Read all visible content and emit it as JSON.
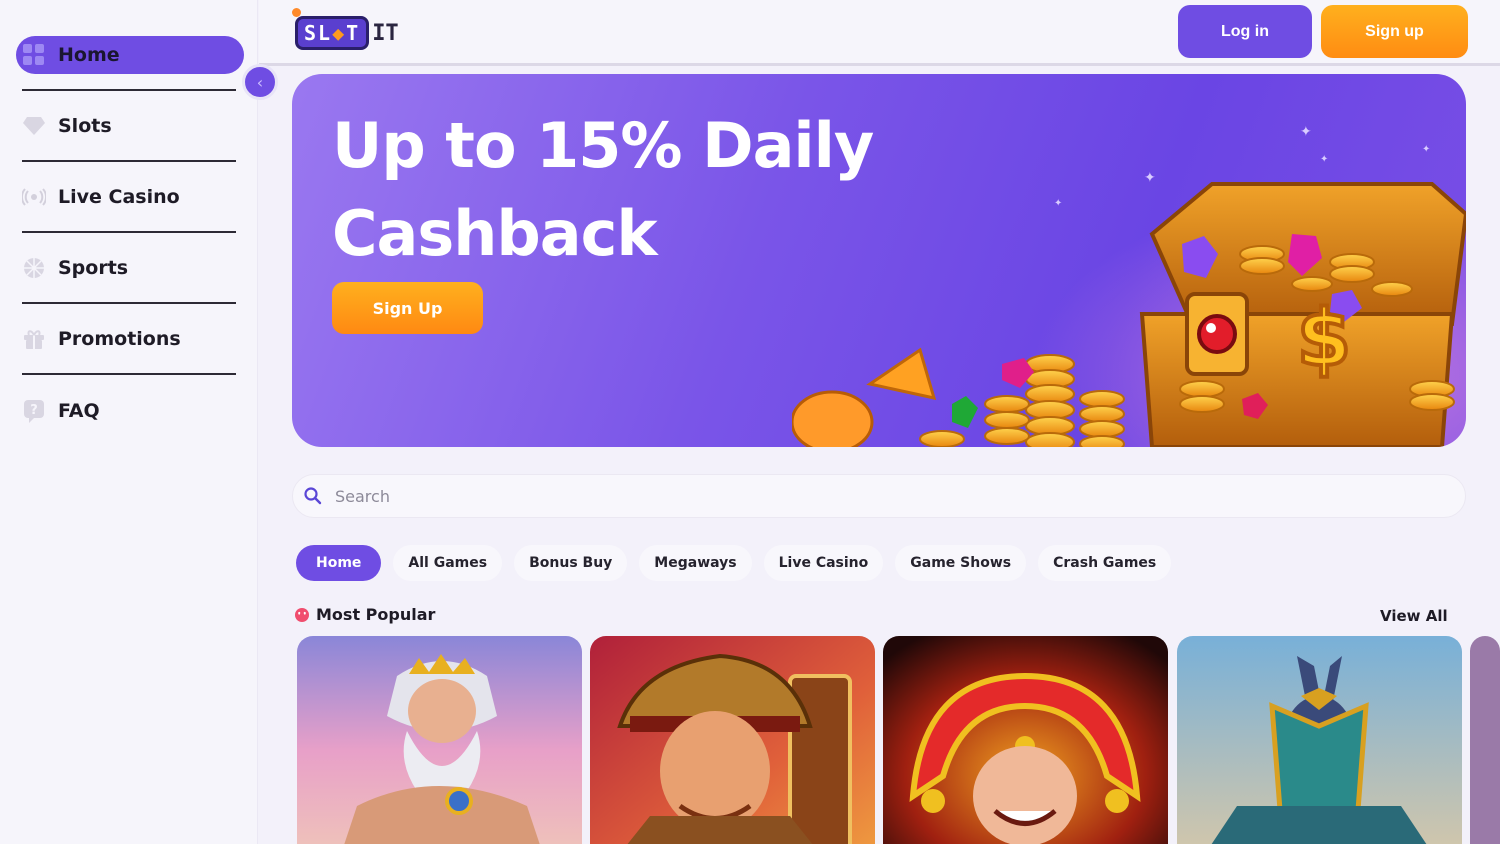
{
  "sidebar": {
    "items": [
      {
        "label": "Home",
        "icon": "grid-icon"
      },
      {
        "label": "Slots",
        "icon": "diamond-icon"
      },
      {
        "label": "Live Casino",
        "icon": "broadcast-icon"
      },
      {
        "label": "Sports",
        "icon": "ball-icon"
      },
      {
        "label": "Promotions",
        "icon": "gift-icon"
      },
      {
        "label": "FAQ",
        "icon": "question-icon"
      }
    ],
    "active": "Home"
  },
  "header": {
    "logo": "SLOTIT",
    "login_label": "Log in",
    "signup_label": "Sign up"
  },
  "banner": {
    "title_line1": "Up to 15% Daily",
    "title_line2": "Cashback",
    "cta_label": "Sign Up"
  },
  "search": {
    "placeholder": "Search",
    "value": ""
  },
  "tabs": [
    {
      "label": "Home"
    },
    {
      "label": "All Games"
    },
    {
      "label": "Bonus Buy"
    },
    {
      "label": "Megaways"
    },
    {
      "label": "Live Casino"
    },
    {
      "label": "Game Shows"
    },
    {
      "label": "Crash Games"
    }
  ],
  "section": {
    "title": "Most Popular",
    "view_all_label": "View All"
  },
  "colors": {
    "accent": "#6f4de3",
    "orange": "#ff9a18",
    "background": "#f3f1fa"
  }
}
